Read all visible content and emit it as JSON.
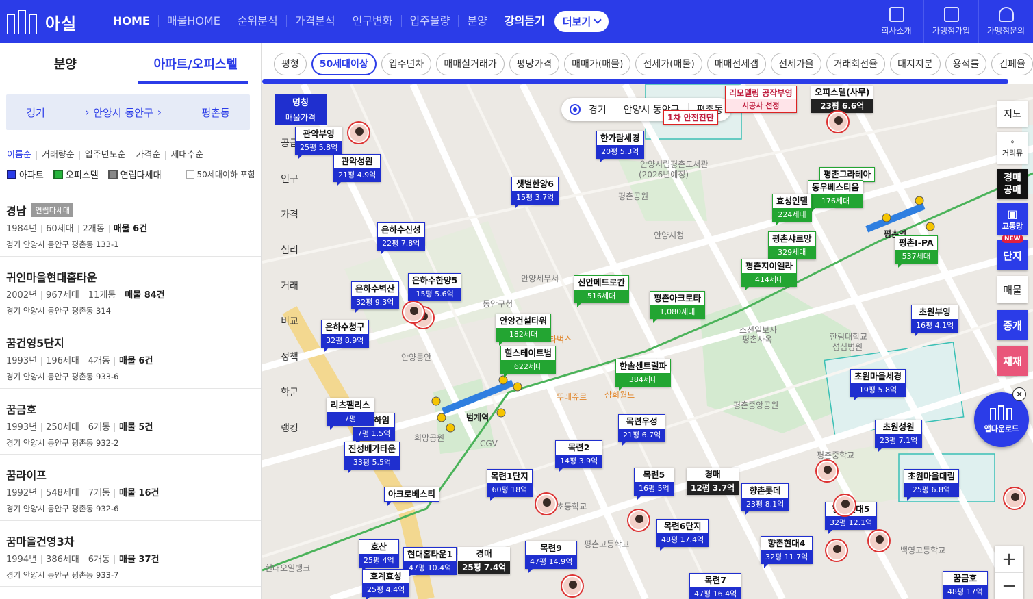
{
  "header": {
    "logo_text": "아실",
    "nav": [
      "HOME",
      "매물HOME",
      "순위분석",
      "가격분석",
      "인구변화",
      "입주물량",
      "분양",
      "강의듣기"
    ],
    "more_label": "더보기",
    "actions": [
      {
        "label": "회사소개",
        "icon": "building-icon"
      },
      {
        "label": "가맹점가입",
        "icon": "signin-icon"
      },
      {
        "label": "가맹점문의",
        "icon": "person-stars-icon"
      }
    ]
  },
  "left": {
    "tabs": [
      "분양",
      "아파트/오피스텔"
    ],
    "breadcrumb": [
      "경기",
      "안양시 동안구",
      "평촌동"
    ],
    "sorts": [
      "이름순",
      "거래량순",
      "입주년도순",
      "가격순",
      "세대수순"
    ],
    "filters": {
      "apt": "아파트",
      "officetel": "오피스텔",
      "villa": "연립다세대",
      "include_small": "50세대이하 포함"
    },
    "items": [
      {
        "name": "경남",
        "badge": "연립다세대",
        "year": "1984년",
        "households": "60세대",
        "buildings": "2개동",
        "deals": "매물 6건",
        "addr": "경기 안양시 동안구 평촌동 133-1"
      },
      {
        "name": "귀인마을현대홈타운",
        "badge": "",
        "year": "2002년",
        "households": "967세대",
        "buildings": "11개동",
        "deals": "매물 84건",
        "addr": "경기 안양시 동안구 평촌동 314"
      },
      {
        "name": "꿈건영5단지",
        "badge": "",
        "year": "1993년",
        "households": "196세대",
        "buildings": "4개동",
        "deals": "매물 6건",
        "addr": "경기 안양시 동안구 평촌동 933-6"
      },
      {
        "name": "꿈금호",
        "badge": "",
        "year": "1993년",
        "households": "250세대",
        "buildings": "6개동",
        "deals": "매물 5건",
        "addr": "경기 안양시 동안구 평촌동 932-2"
      },
      {
        "name": "꿈라이프",
        "badge": "",
        "year": "1992년",
        "households": "548세대",
        "buildings": "7개동",
        "deals": "매물 16건",
        "addr": "경기 안양시 동안구 평촌동 932-6"
      },
      {
        "name": "꿈마을건영3차",
        "badge": "",
        "year": "1994년",
        "households": "386세대",
        "buildings": "6개동",
        "deals": "매물 37건",
        "addr": "경기 안양시 동안구 평촌동 933-7"
      }
    ]
  },
  "filter_chips": [
    "평형",
    "50세대이상",
    "입주년차",
    "매매실거래가",
    "평당가격",
    "매매가(매물)",
    "전세가(매물)",
    "매매전세갭",
    "전세가율",
    "거래회전율",
    "대지지분",
    "용적률",
    "건폐율"
  ],
  "active_chip": "50세대이상",
  "map": {
    "region_pill": [
      "경기",
      "안양시 동안구",
      "평촌동"
    ],
    "name_selector": {
      "title": "명칭",
      "sub": "매물가격"
    },
    "side_menu": [
      "공급",
      "인구",
      "가격",
      "심리",
      "거래",
      "비교",
      "정책",
      "학군",
      "랭킹"
    ],
    "right_controls": {
      "region": "지도",
      "distance": "거리뮤",
      "auction": "경매\n공매",
      "transit": "교통망",
      "complex": "단지",
      "new_tag": "NEW",
      "listing": "매물",
      "agent": "중개",
      "redev": "재재",
      "app": "앱다운로드"
    },
    "markers_blue": [
      {
        "name": "관악부영",
        "price": "25평 5.8억"
      },
      {
        "name": "관악성원",
        "price": "21평 4.9억"
      },
      {
        "name": "샛별한양6",
        "price": "15평 3.7억"
      },
      {
        "name": "은하수신성",
        "price": "22평 7.8억"
      },
      {
        "name": "은하수벽산",
        "price": "32평 9.3억"
      },
      {
        "name": "은하수한양5",
        "price": "15평 5.6억"
      },
      {
        "name": "은하수청구",
        "price": "32평 8.9억"
      },
      {
        "name": "한가람세경",
        "price": "20평 5.3억"
      },
      {
        "name": "한스하임",
        "price": "7평 1.5억"
      },
      {
        "name": "진성베가타운",
        "price": "33평 5.5억"
      },
      {
        "name": "목련2",
        "price": "14평 3.9억"
      },
      {
        "name": "목련우성",
        "price": "21평 6.7억"
      },
      {
        "name": "목련1단지",
        "price": "60평 18억"
      },
      {
        "name": "목련5",
        "price": "16평 5억"
      },
      {
        "name": "향촌롯데",
        "price": "23평 8.1억"
      },
      {
        "name": "목련6단지",
        "price": "48평 17.4억"
      },
      {
        "name": "목련9",
        "price": "47평 14.9억"
      },
      {
        "name": "호산",
        "price": "25평 4억"
      },
      {
        "name": "현대홈타운1",
        "price": "47평 10.4억"
      },
      {
        "name": "호계효성",
        "price": "25평 4.4억"
      },
      {
        "name": "목련7",
        "price": "47평 16.4억"
      },
      {
        "name": "향촌현대4",
        "price": "32평 11.7억"
      },
      {
        "name": "향촌현대5",
        "price": "32평 12.1억"
      },
      {
        "name": "초원부영",
        "price": "16평 4.1억"
      },
      {
        "name": "초원마을세경",
        "price": "19평 5.8억"
      },
      {
        "name": "초원성원",
        "price": "23평 7.1억"
      },
      {
        "name": "초원마을대림",
        "price": "25평 6.8억"
      },
      {
        "name": "꿈금호",
        "price": "48평 17억"
      },
      {
        "name": "리츠팰리스",
        "price": "7평"
      },
      {
        "name": "아크로베스티",
        "price": ""
      }
    ],
    "markers_green": [
      {
        "name": "신안메트로칸",
        "count": "516세대"
      },
      {
        "name": "평촌아크로타",
        "count": "1,080세대"
      },
      {
        "name": "안양건설타워",
        "count": "182세대"
      },
      {
        "name": "힐스테이트범",
        "count": "622세대"
      },
      {
        "name": "한솔센트럴파",
        "count": "384세대"
      },
      {
        "name": "평촌그라테아",
        "count": ""
      },
      {
        "name": "동우베스티움",
        "count": "176세대"
      },
      {
        "name": "효성인텔",
        "count": "224세대"
      },
      {
        "name": "평촌샤르망",
        "count": "329세대"
      },
      {
        "name": "평촌지이엘라",
        "count": "414세대"
      },
      {
        "name": "평촌I-PA",
        "count": "537세대"
      }
    ],
    "markers_auction": [
      {
        "name": "경매",
        "price": "12평 3.7억"
      },
      {
        "name": "경매",
        "price": "25평 7.4억"
      },
      {
        "name": "오피스텔(사무)",
        "price": "23평 6.6억"
      }
    ],
    "markers_red": [
      {
        "name": "리모델링 공작부영",
        "sub": "시공사 선정"
      },
      {
        "name": "1차 안전진단",
        "sub": ""
      }
    ],
    "pois": [
      "안양시청",
      "평촌공원",
      "평촌중앙공원",
      "범계역",
      "평촌역",
      "안양시립평촌도서관 (2026년예정)",
      "조선일보사 평촌사옥",
      "한림대학교 성심병원",
      "평촌중학교",
      "백영고등학교",
      "평촌고등학교",
      "범계초등학교",
      "스타벅스",
      "뚜레쥬르",
      "CGV",
      "희망공원",
      "현대오일뱅크",
      "삼희월드 프라자",
      "안양동안경찰서",
      "안양세무서",
      "동안구청"
    ]
  }
}
